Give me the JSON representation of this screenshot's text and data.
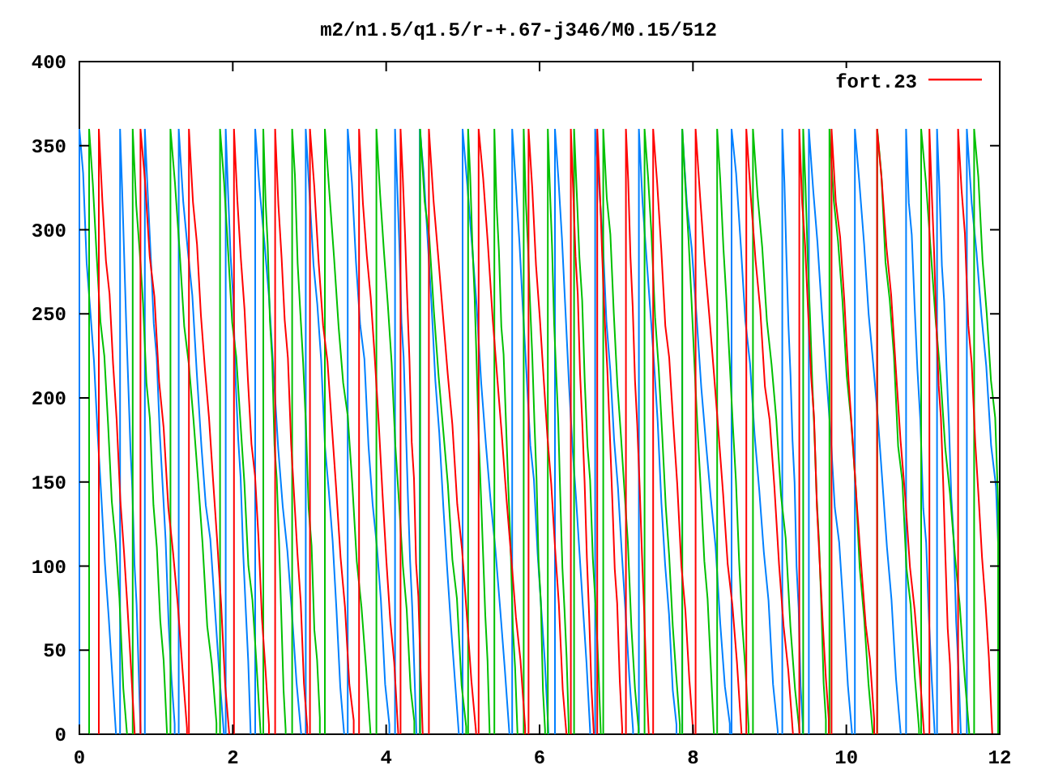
{
  "title": "m2/n1.5/q1.5/r-+.67-j346/M0.15/512",
  "y_ticks": [
    "400",
    "350",
    "300",
    "250",
    "200",
    "150",
    "100",
    "50",
    "0"
  ],
  "x_ticks": [
    "0",
    "2",
    "4",
    "6",
    "8",
    "10",
    "12"
  ],
  "legend": {
    "label": "fort.23",
    "color": "#ff0000"
  }
}
